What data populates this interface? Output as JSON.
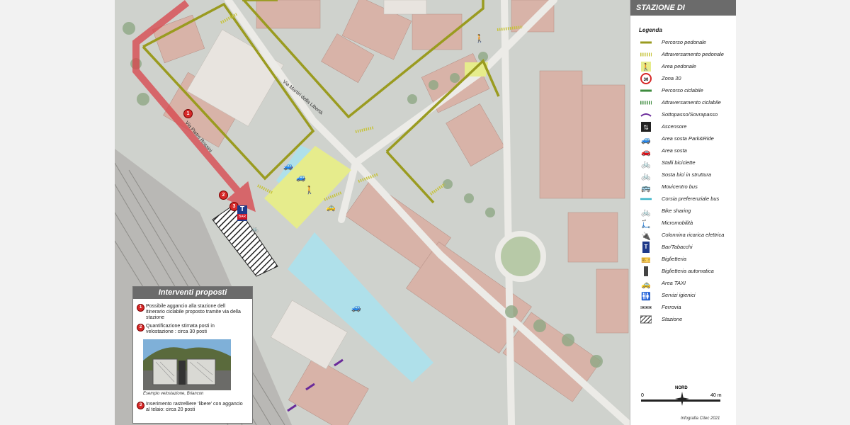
{
  "legend": {
    "header": "STAZIONE DI MONCALIERI",
    "title": "Legenda",
    "items": [
      {
        "label": "Percorso pedonale",
        "icon": "pedestrian-path-line-icon"
      },
      {
        "label": "Attraversamento pedonale",
        "icon": "pedestrian-crossing-icon"
      },
      {
        "label": "Area pedonale",
        "icon": "pedestrian-area-icon"
      },
      {
        "label": "Zona 30",
        "icon": "zone-30-sign-icon"
      },
      {
        "label": "Percorso ciclabile",
        "icon": "cycle-path-line-icon"
      },
      {
        "label": "Attraversamento ciclabile",
        "icon": "cycle-crossing-icon"
      },
      {
        "label": "Sottopasso/Sovrapasso",
        "icon": "underpass-icon"
      },
      {
        "label": "Ascensore",
        "icon": "elevator-icon"
      },
      {
        "label": "Area sosta Park&Ride",
        "icon": "park-ride-icon"
      },
      {
        "label": "Area sosta",
        "icon": "parking-car-icon"
      },
      {
        "label": "Stalli biciclette",
        "icon": "bicycle-rack-icon"
      },
      {
        "label": "Sosta bici in struttura",
        "icon": "bicycle-shelter-icon"
      },
      {
        "label": "Movicentro bus",
        "icon": "bus-hub-icon"
      },
      {
        "label": "Corsia preferenziale bus",
        "icon": "bus-lane-icon"
      },
      {
        "label": "Bike sharing",
        "icon": "bike-sharing-icon"
      },
      {
        "label": "Micromobilità",
        "icon": "micromobility-icon"
      },
      {
        "label": "Colonnina ricarica elettrica",
        "icon": "ev-charger-icon"
      },
      {
        "label": "Bar/Tabacchi",
        "icon": "bar-tabacchi-icon"
      },
      {
        "label": "Biglietteria",
        "icon": "ticket-office-icon"
      },
      {
        "label": "Biglietteria automatica",
        "icon": "ticket-machine-icon"
      },
      {
        "label": "Area TAXI",
        "icon": "taxi-icon"
      },
      {
        "label": "Servizi igienici",
        "icon": "toilets-icon"
      },
      {
        "label": "Ferrovia",
        "icon": "railway-icon"
      },
      {
        "label": "Stazione",
        "icon": "station-hatch-icon"
      }
    ]
  },
  "map": {
    "street_labels": [
      "Via Martiri della Libertà",
      "Via Pietro Rossini"
    ],
    "markers": [
      "1",
      "2",
      "3"
    ],
    "bar_sign": "BAR",
    "bar_letter": "T"
  },
  "interventions": {
    "title": "Interventi proposti",
    "items": [
      {
        "num": "1",
        "text": "Possibile aggancio alla stazione dell itinerario ciclabile proposto tramite via della stazione"
      },
      {
        "num": "2",
        "text": "Quantificazione stimata posti in velostazione : circa 30 posti"
      },
      {
        "num": "3",
        "text": "Inserimento rastrelliere ‘libere’ con aggancio al telaio: circa 20 posti"
      }
    ],
    "photo_caption": "Esempio velostazione, Briancon"
  },
  "scale": {
    "north": "NORD",
    "min": "0",
    "max": "40 m"
  },
  "credit": "Infografia Citec 2021",
  "colors": {
    "pedestrian": "#9a9b20",
    "cycle_route": "#d9434a",
    "pedestrian_area": "#e6ec8c",
    "parking": "#a9e3ef",
    "marker": "#d62828",
    "header_bg": "#6b6b6b"
  }
}
